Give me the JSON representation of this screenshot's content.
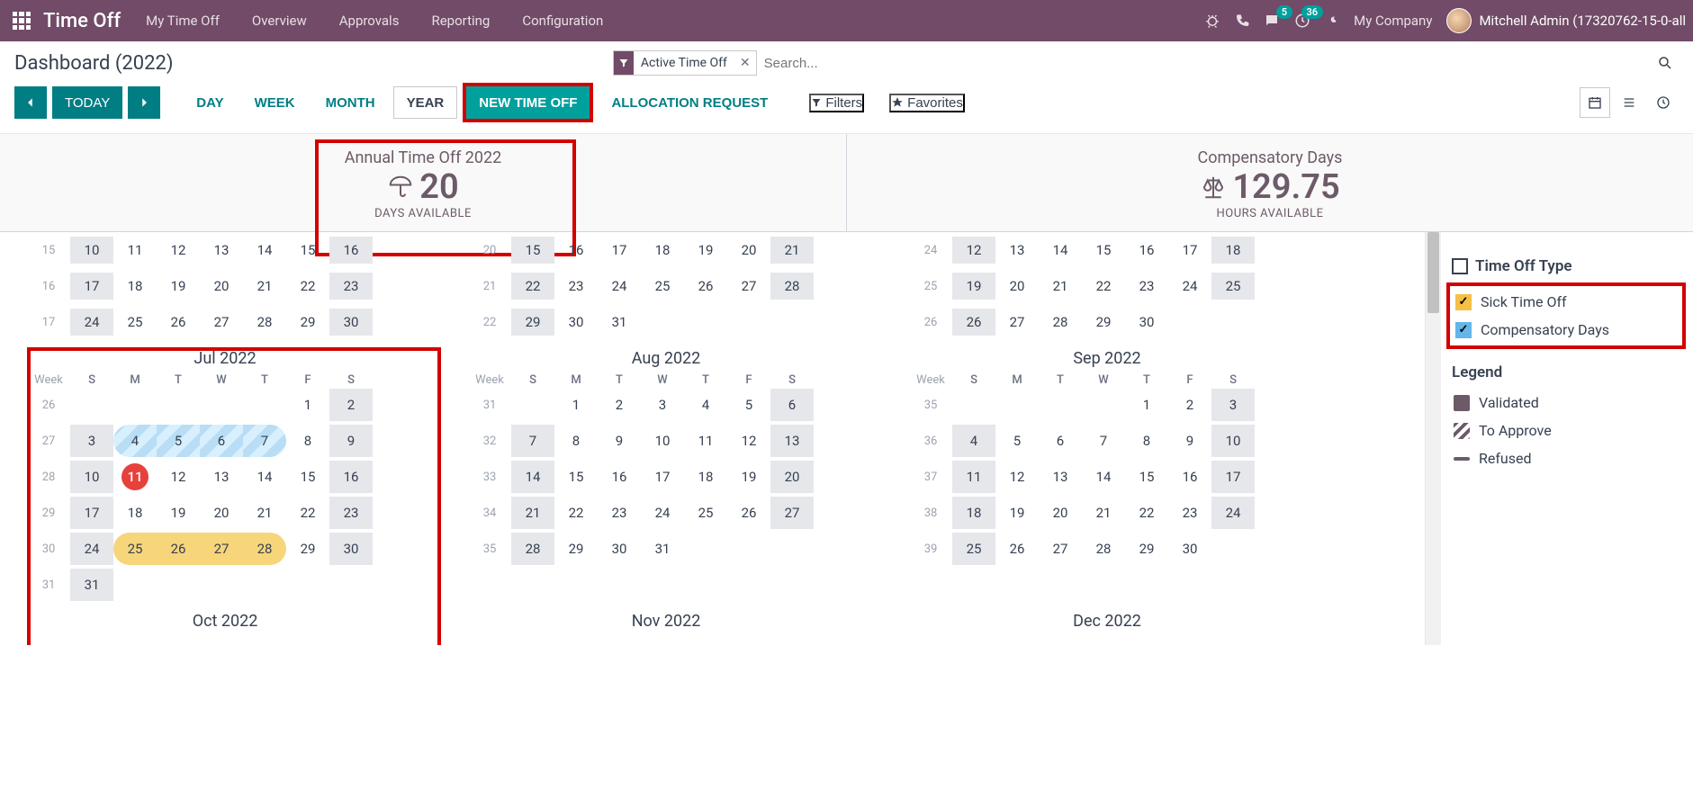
{
  "navbar": {
    "brand": "Time Off",
    "menu": [
      "My Time Off",
      "Overview",
      "Approvals",
      "Reporting",
      "Configuration"
    ],
    "company": "My Company",
    "user": "Mitchell Admin (17320762-15-0-all",
    "badge_messages": "5",
    "badge_activities": "36"
  },
  "page_title": "Dashboard (2022)",
  "search": {
    "facet_label": "Active Time Off",
    "placeholder": "Search..."
  },
  "toolbar": {
    "today": "TODAY",
    "day": "DAY",
    "week": "WEEK",
    "month": "MONTH",
    "year": "YEAR",
    "new_time_off": "NEW TIME OFF",
    "allocation_request": "ALLOCATION REQUEST",
    "filters": "Filters",
    "favorites": "Favorites"
  },
  "summary": {
    "annual": {
      "title": "Annual Time Off 2022",
      "value": "20",
      "sub": "DAYS AVAILABLE"
    },
    "comp": {
      "title": "Compensatory Days",
      "value": "129.75",
      "sub": "HOURS AVAILABLE"
    }
  },
  "day_headers": {
    "week": "Week",
    "S1": "S",
    "M": "M",
    "T1": "T",
    "W": "W",
    "T2": "T",
    "F": "F",
    "S2": "S"
  },
  "partial_rows": {
    "m1": {
      "weeks": [
        "15",
        "16",
        "17"
      ],
      "days": [
        [
          "10",
          "11",
          "12",
          "13",
          "14",
          "15",
          "16"
        ],
        [
          "17",
          "18",
          "19",
          "20",
          "21",
          "22",
          "23"
        ],
        [
          "24",
          "25",
          "26",
          "27",
          "28",
          "29",
          "30"
        ]
      ]
    },
    "m2": {
      "weeks": [
        "20",
        "21",
        "22"
      ],
      "days": [
        [
          "15",
          "16",
          "17",
          "18",
          "19",
          "20",
          "21"
        ],
        [
          "22",
          "23",
          "24",
          "25",
          "26",
          "27",
          "28"
        ],
        [
          "29",
          "30",
          "31",
          "",
          "",
          "",
          ""
        ]
      ]
    },
    "m3": {
      "weeks": [
        "24",
        "25",
        "26"
      ],
      "days": [
        [
          "12",
          "13",
          "14",
          "15",
          "16",
          "17",
          "18"
        ],
        [
          "19",
          "20",
          "21",
          "22",
          "23",
          "24",
          "25"
        ],
        [
          "26",
          "27",
          "28",
          "29",
          "30",
          "",
          ""
        ]
      ]
    }
  },
  "months": {
    "jul": {
      "title": "Jul 2022",
      "weeks": [
        "26",
        "27",
        "28",
        "29",
        "30",
        "31"
      ],
      "grid": [
        [
          "",
          "",
          "",
          "",
          "",
          "1",
          "2"
        ],
        [
          "3",
          "4",
          "5",
          "6",
          "7",
          "8",
          "9"
        ],
        [
          "10",
          "11",
          "12",
          "13",
          "14",
          "15",
          "16"
        ],
        [
          "17",
          "18",
          "19",
          "20",
          "21",
          "22",
          "23"
        ],
        [
          "24",
          "25",
          "26",
          "27",
          "28",
          "29",
          "30"
        ],
        [
          "31",
          "",
          "",
          "",
          "",
          "",
          ""
        ]
      ],
      "today": "11",
      "blue_range": [
        "4",
        "5",
        "6",
        "7"
      ],
      "yellow_range": [
        "25",
        "26",
        "27",
        "28"
      ]
    },
    "aug": {
      "title": "Aug 2022",
      "weeks": [
        "31",
        "32",
        "33",
        "34",
        "35"
      ],
      "grid": [
        [
          "",
          "1",
          "2",
          "3",
          "4",
          "5",
          "6"
        ],
        [
          "7",
          "8",
          "9",
          "10",
          "11",
          "12",
          "13"
        ],
        [
          "14",
          "15",
          "16",
          "17",
          "18",
          "19",
          "20"
        ],
        [
          "21",
          "22",
          "23",
          "24",
          "25",
          "26",
          "27"
        ],
        [
          "28",
          "29",
          "30",
          "31",
          "",
          "",
          ""
        ]
      ]
    },
    "sep": {
      "title": "Sep 2022",
      "weeks": [
        "35",
        "36",
        "37",
        "38",
        "39"
      ],
      "grid": [
        [
          "",
          "",
          "",
          "",
          "1",
          "2",
          "3"
        ],
        [
          "4",
          "5",
          "6",
          "7",
          "8",
          "9",
          "10"
        ],
        [
          "11",
          "12",
          "13",
          "14",
          "15",
          "16",
          "17"
        ],
        [
          "18",
          "19",
          "20",
          "21",
          "22",
          "23",
          "24"
        ],
        [
          "25",
          "26",
          "27",
          "28",
          "29",
          "30",
          ""
        ]
      ]
    },
    "oct": {
      "title": "Oct 2022"
    },
    "nov": {
      "title": "Nov 2022"
    },
    "dec": {
      "title": "Dec 2022"
    }
  },
  "legend": {
    "type_header": "Time Off Type",
    "sick": "Sick Time Off",
    "comp": "Compensatory Days",
    "legend_header": "Legend",
    "validated": "Validated",
    "to_approve": "To Approve",
    "refused": "Refused"
  }
}
